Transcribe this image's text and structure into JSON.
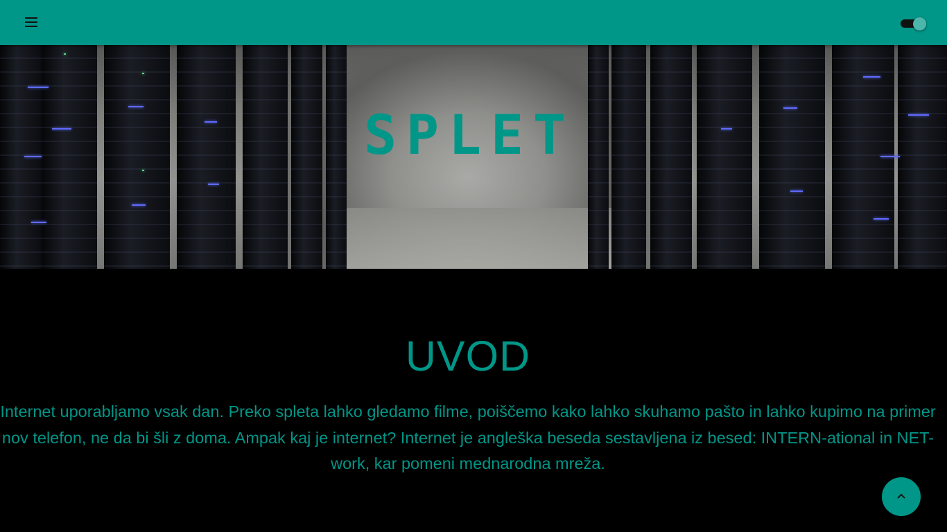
{
  "header": {
    "menu_icon": "menu-icon",
    "theme_toggle": {
      "icon": "toggle-switch",
      "state": "on"
    },
    "colors": {
      "bar": "#009688"
    }
  },
  "hero": {
    "logo_text": "SPLET",
    "logo_color": "#009688"
  },
  "section": {
    "title": "UVOD",
    "paragraph": "Internet uporabljamo vsak dan. Preko spleta lahko gledamo filme, poiščemo kako lahko skuhamo pašto in lahko kupimo na primer nov telefon, ne da bi šli z doma. Ampak kaj je internet? Internet je angleška beseda sestavljena iz besed: INTERN-ational in NET-work, kar pomeni mednarodna mreža."
  },
  "back_to_top": {
    "icon": "chevron-up-icon"
  }
}
